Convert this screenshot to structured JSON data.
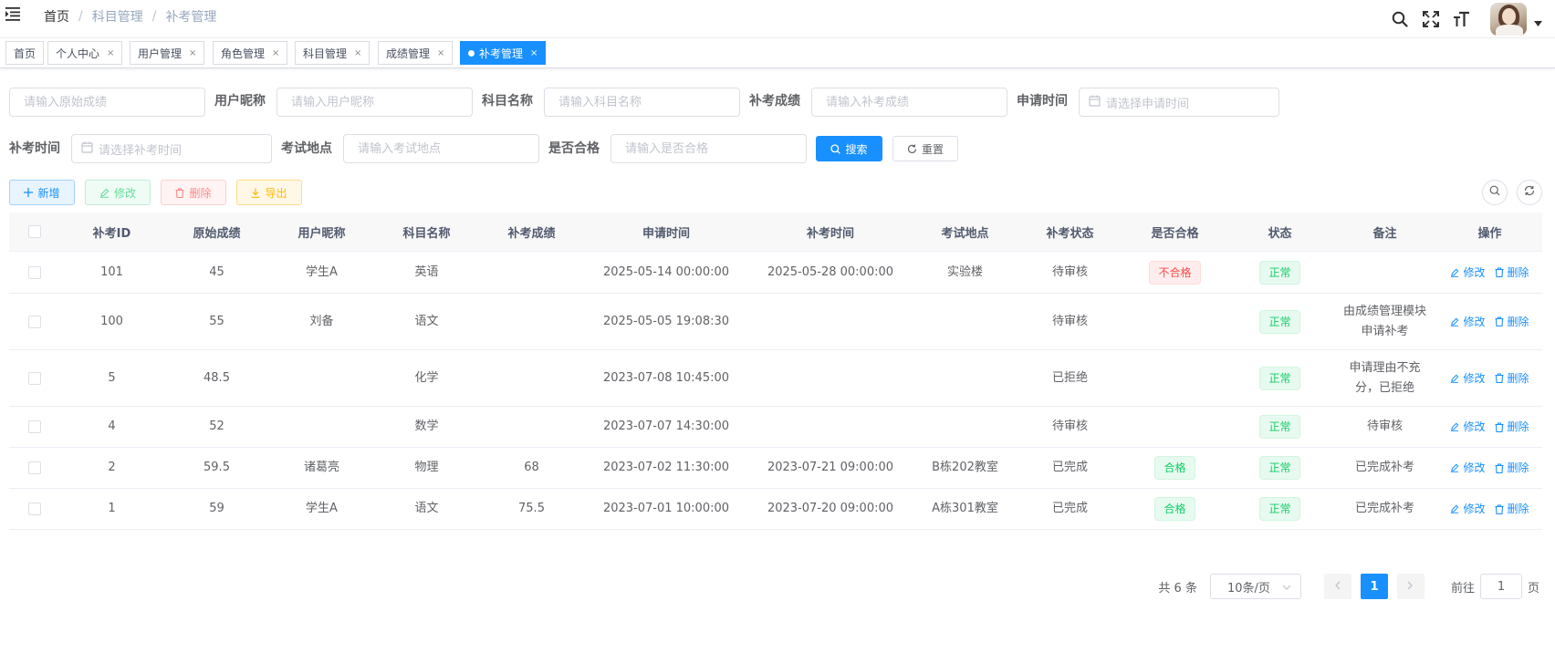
{
  "breadcrumb": [
    "首页",
    "科目管理",
    "补考管理"
  ],
  "tags": [
    {
      "label": "首页",
      "closable": false
    },
    {
      "label": "个人中心",
      "closable": true
    },
    {
      "label": "用户管理",
      "closable": true
    },
    {
      "label": "角色管理",
      "closable": true
    },
    {
      "label": "科目管理",
      "closable": true
    },
    {
      "label": "成绩管理",
      "closable": true
    },
    {
      "label": "补考管理",
      "closable": true,
      "active": true
    }
  ],
  "filters": {
    "original_score": {
      "placeholder": "请输入原始成绩"
    },
    "nickname": {
      "label": "用户昵称",
      "placeholder": "请输入用户昵称"
    },
    "subject": {
      "label": "科目名称",
      "placeholder": "请输入科目名称"
    },
    "makeup_score": {
      "label": "补考成绩",
      "placeholder": "请输入补考成绩"
    },
    "apply_time": {
      "label": "申请时间",
      "placeholder": "请选择申请时间"
    },
    "makeup_time": {
      "label": "补考时间",
      "placeholder": "请选择补考时间"
    },
    "location": {
      "label": "考试地点",
      "placeholder": "请输入考试地点"
    },
    "passed": {
      "label": "是否合格",
      "placeholder": "请输入是否合格"
    },
    "search_label": "搜索",
    "reset_label": "重置"
  },
  "toolbar": {
    "add_label": "新增",
    "edit_label": "修改",
    "delete_label": "删除",
    "export_label": "导出"
  },
  "table": {
    "columns": [
      "补考ID",
      "原始成绩",
      "用户昵称",
      "科目名称",
      "补考成绩",
      "申请时间",
      "补考时间",
      "考试地点",
      "补考状态",
      "是否合格",
      "状态",
      "备注",
      "操作"
    ],
    "rows": [
      {
        "id": "101",
        "orig": "45",
        "nick": "学生A",
        "subject": "英语",
        "makeup": "",
        "apply": "2025-05-14 00:00:00",
        "mtime": "2025-05-28 00:00:00",
        "loc": "实验楼",
        "mstatus": "待审核",
        "pass": "不合格",
        "pass_type": "danger",
        "status": "正常",
        "remark": "",
        "h": 46
      },
      {
        "id": "100",
        "orig": "55",
        "nick": "刘备",
        "subject": "语文",
        "makeup": "",
        "apply": "2025-05-05 19:08:30",
        "mtime": "",
        "loc": "",
        "mstatus": "待审核",
        "pass": "",
        "pass_type": "",
        "status": "正常",
        "remark": "由成绩管理模块申请补考",
        "h": 62
      },
      {
        "id": "5",
        "orig": "48.5",
        "nick": "",
        "subject": "化学",
        "makeup": "",
        "apply": "2023-07-08 10:45:00",
        "mtime": "",
        "loc": "",
        "mstatus": "已拒绝",
        "pass": "",
        "pass_type": "",
        "status": "正常",
        "remark": "申请理由不充分，已拒绝",
        "h": 62
      },
      {
        "id": "4",
        "orig": "52",
        "nick": "",
        "subject": "数学",
        "makeup": "",
        "apply": "2023-07-07 14:30:00",
        "mtime": "",
        "loc": "",
        "mstatus": "待审核",
        "pass": "",
        "pass_type": "",
        "status": "正常",
        "remark": "待审核",
        "h": 45
      },
      {
        "id": "2",
        "orig": "59.5",
        "nick": "诸葛亮",
        "subject": "物理",
        "makeup": "68",
        "apply": "2023-07-02 11:30:00",
        "mtime": "2023-07-21 09:00:00",
        "loc": "B栋202教室",
        "mstatus": "已完成",
        "pass": "合格",
        "pass_type": "success",
        "status": "正常",
        "remark": "已完成补考",
        "h": 45
      },
      {
        "id": "1",
        "orig": "59",
        "nick": "学生A",
        "subject": "语文",
        "makeup": "75.5",
        "apply": "2023-07-01 10:00:00",
        "mtime": "2023-07-20 09:00:00",
        "loc": "A栋301教室",
        "mstatus": "已完成",
        "pass": "合格",
        "pass_type": "success",
        "status": "正常",
        "remark": "已完成补考",
        "h": 45
      }
    ],
    "op_edit": "修改",
    "op_delete": "删除"
  },
  "pagination": {
    "total": "共 6 条",
    "page_size": "10条/页",
    "current_page": "1",
    "goto_prefix": "前往",
    "goto_value": "1",
    "goto_suffix": "页"
  },
  "colors": {
    "primary": "#1890ff",
    "success": "#13ce66",
    "danger": "#ff4949",
    "warning": "#ffba00"
  }
}
